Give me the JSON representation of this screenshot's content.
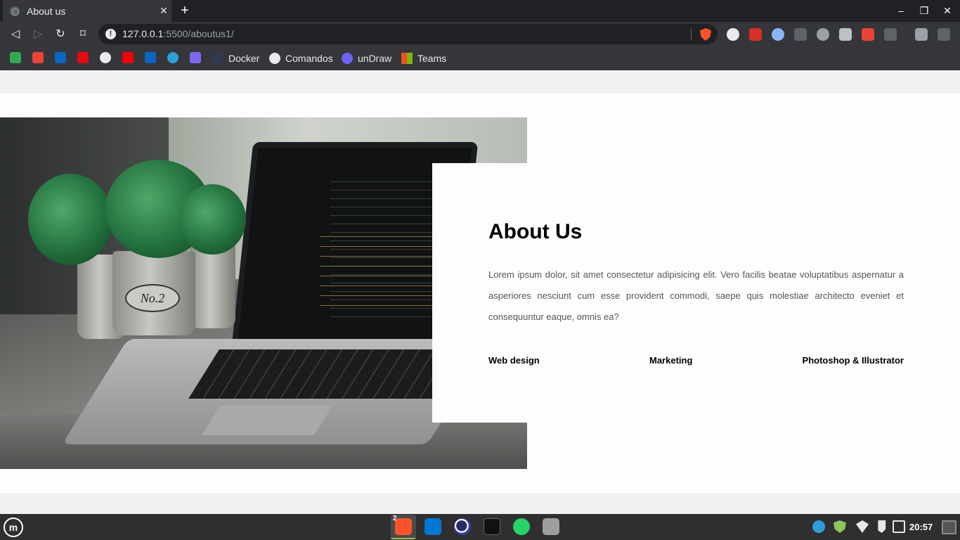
{
  "browser": {
    "tab_title": "About us",
    "tab_close": "✕",
    "new_tab": "+",
    "window_controls": {
      "minimize": "–",
      "maximize": "❐",
      "close": "✕"
    },
    "nav": {
      "back": "◁",
      "forward": "▷",
      "reload": "↻",
      "bookmark": "⌑"
    },
    "url_info_glyph": "!",
    "url_host": "127.0.0.1",
    "url_rest": ":5500/aboutus1/",
    "bookmarks": [
      "Docker",
      "Comandos",
      "unDraw",
      "Teams"
    ],
    "brand_color": "#fb542b"
  },
  "photo": {
    "pot_label": "No.2"
  },
  "about": {
    "title": "About Us",
    "body": "Lorem ipsum dolor, sit amet consectetur adipisicing elit. Vero facilis beatae voluptatibus aspernatur a asperiores nesciunt cum esse provident commodi, saepe quis molestiae architecto eveniet et consequuntur eaque, omnis ea?",
    "skills": [
      "Web design",
      "Marketing",
      "Photoshop & Illustrator"
    ]
  },
  "taskbar": {
    "menu_glyph": "m",
    "badge_count": "2",
    "clock": "20:57",
    "accent": "#8fc459"
  }
}
